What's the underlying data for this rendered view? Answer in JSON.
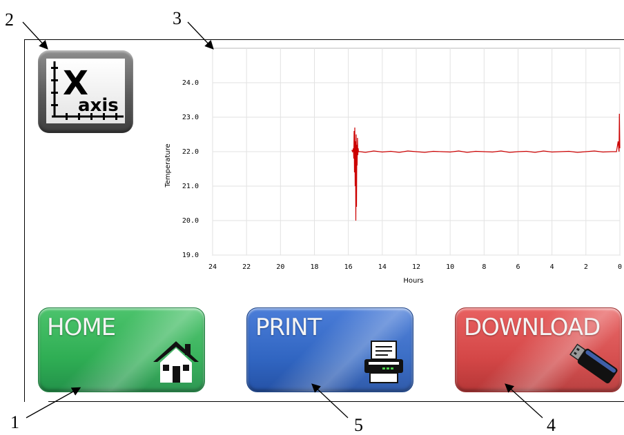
{
  "callouts": [
    "1",
    "2",
    "3",
    "4",
    "5"
  ],
  "xaxis_button": {
    "icon": "x-axis-icon",
    "line1": "X",
    "line2": "axis"
  },
  "buttons": {
    "home": {
      "label": "HOME",
      "icon": "house-icon",
      "color": "#2fae54"
    },
    "print": {
      "label": "PRINT",
      "icon": "printer-icon",
      "color": "#3166c2"
    },
    "download": {
      "label": "DOWNLOAD",
      "icon": "usb-drive-icon",
      "color": "#d44747"
    }
  },
  "chart_data": {
    "type": "line",
    "title": "",
    "xlabel": "Hours",
    "ylabel": "Temperature",
    "xlim": [
      24,
      0
    ],
    "ylim": [
      19.0,
      25.0
    ],
    "x_ticks": [
      24,
      22,
      20,
      18,
      16,
      14,
      12,
      10,
      8,
      6,
      4,
      2,
      0
    ],
    "y_ticks": [
      "19.0",
      "20.0",
      "21.0",
      "22.0",
      "23.0",
      "24.0"
    ],
    "grid": true,
    "series": [
      {
        "color": "#cc0000",
        "x": [
          15.8,
          15.75,
          15.7,
          15.68,
          15.66,
          15.64,
          15.62,
          15.6,
          15.58,
          15.56,
          15.54,
          15.52,
          15.5,
          15.48,
          15.46,
          15.44,
          15.42,
          15.4,
          15.3,
          15.0,
          14.5,
          14.0,
          13.5,
          13.0,
          12.5,
          12.0,
          11.5,
          11.0,
          10.5,
          10.0,
          9.5,
          9.0,
          8.5,
          8.0,
          7.5,
          7.0,
          6.5,
          6.0,
          5.5,
          5.0,
          4.5,
          4.0,
          3.5,
          3.0,
          2.5,
          2.0,
          1.5,
          1.0,
          0.5,
          0.2,
          0.1,
          0.05,
          0.03,
          0.0
        ],
        "y": [
          22.05,
          22.0,
          22.1,
          21.8,
          22.6,
          21.4,
          22.7,
          21.0,
          22.3,
          20.0,
          22.5,
          20.4,
          22.2,
          21.6,
          22.4,
          21.9,
          22.1,
          22.0,
          22.0,
          21.98,
          22.02,
          21.99,
          22.01,
          21.98,
          22.02,
          22.0,
          21.98,
          22.01,
          22.0,
          21.99,
          22.02,
          21.98,
          22.01,
          22.0,
          21.99,
          22.02,
          21.98,
          22.0,
          22.01,
          21.98,
          22.02,
          21.99,
          22.0,
          22.01,
          21.98,
          22.0,
          22.02,
          21.99,
          22.0,
          22.0,
          22.3,
          22.0,
          23.1,
          22.1
        ]
      }
    ]
  }
}
